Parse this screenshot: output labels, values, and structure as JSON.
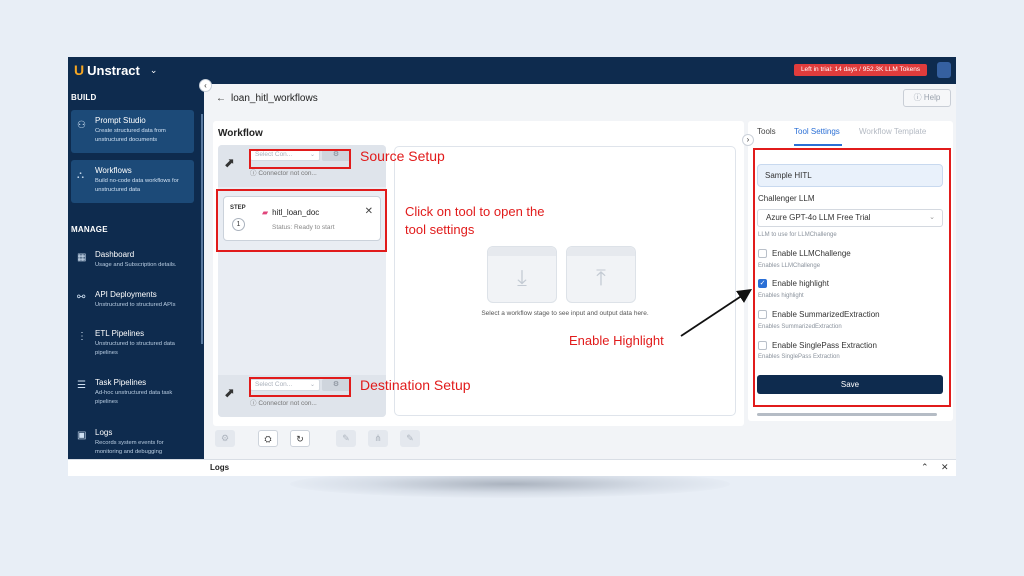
{
  "app": {
    "logo_text": "Unstract",
    "logo_chevron": "⌄",
    "trial_text": "Left in trial: 14 days / 952.3K LLM Tokens"
  },
  "sidebar": {
    "build_label": "BUILD",
    "manage_label": "MANAGE",
    "build_items": [
      {
        "label": "Prompt Studio",
        "desc": "Create structured data from unstructured documents",
        "icon": "prompt-studio-icon"
      },
      {
        "label": "Workflows",
        "desc": "Build no-code data workflows for unstructured data",
        "icon": "workflow-icon"
      }
    ],
    "manage_items": [
      {
        "label": "Dashboard",
        "desc": "Usage and Subscription details.",
        "icon": "dashboard-icon"
      },
      {
        "label": "API Deployments",
        "desc": "Unstructured to structured APIs",
        "icon": "api-icon"
      },
      {
        "label": "ETL Pipelines",
        "desc": "Unstructured to structured data pipelines",
        "icon": "etl-icon"
      },
      {
        "label": "Task Pipelines",
        "desc": "Ad-hoc unstructured data task pipelines",
        "icon": "task-icon"
      },
      {
        "label": "Logs",
        "desc": "Records system events for monitoring and debugging",
        "icon": "logs-icon"
      }
    ]
  },
  "header": {
    "title": "loan_hitl_workflows",
    "help_label": "Help"
  },
  "workflow": {
    "title": "Workflow",
    "source": {
      "select_placeholder": "Select Con...",
      "status": "Connector not con..."
    },
    "destination": {
      "select_placeholder": "Select Con...",
      "status": "Connector not con..."
    },
    "step": {
      "label": "STEP",
      "number": "1",
      "tool_name": "hitl_loan_doc",
      "status": "Status: Ready to start"
    },
    "preview_text": "Select a workflow stage to see input and output data here."
  },
  "right_panel": {
    "tabs": [
      "Tools",
      "Tool Settings",
      "Workflow Template"
    ],
    "active_tab": "Tool Settings",
    "name_value": "Sample HITL",
    "challenger_label": "Challenger LLM",
    "challenger_value": "Azure GPT-4o LLM Free Trial",
    "challenger_hint": "LLM to use for LLMChallenge",
    "options": [
      {
        "label": "Enable LLMChallenge",
        "hint": "Enables LLMChallenge",
        "checked": false
      },
      {
        "label": "Enable highlight",
        "hint": "Enables highlight",
        "checked": true
      },
      {
        "label": "Enable SummarizedExtraction",
        "hint": "Enables SummarizedExtraction",
        "checked": false
      },
      {
        "label": "Enable SinglePass Extraction",
        "hint": "Enables SinglePass Extraction",
        "checked": false
      }
    ],
    "save_label": "Save"
  },
  "logs": {
    "title": "Logs"
  },
  "annotations": {
    "source": "Source Setup",
    "destination": "Destination Setup",
    "click_tool": "Click on tool to open the tool settings",
    "enable_highlight": "Enable Highlight"
  },
  "colors": {
    "brand": "#0e2b4e",
    "accent": "#2a6fd6",
    "annotation": "#e11b1b",
    "trial_badge": "#e03c3c"
  }
}
